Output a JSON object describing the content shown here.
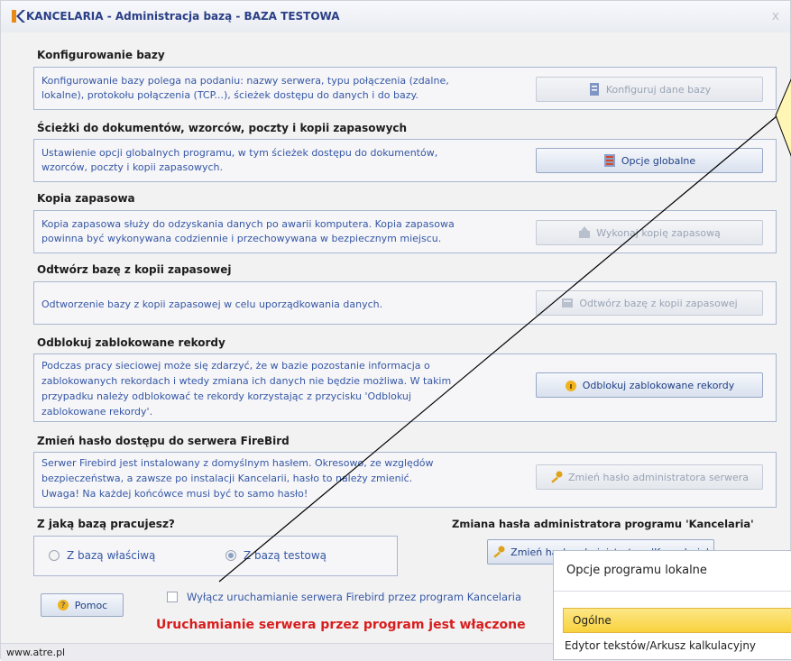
{
  "window": {
    "title": "KANCELARIA - Administracja bazą - BAZA TESTOWA",
    "close_label": "x"
  },
  "sections": {
    "konfiguracja": {
      "heading": "Konfigurowanie bazy",
      "desc_line1": "Konfigurowanie bazy polega na podaniu: nazwy serwera, typu połączenia (zdalne,",
      "desc_line2": "lokalne), protokołu połączenia (TCP...), ścieżek dostępu do danych i do bazy.",
      "button": "Konfiguruj dane bazy"
    },
    "sciezki": {
      "heading": "Ścieżki do dokumentów, wzorców, poczty i kopii zapasowych",
      "desc_line1": "Ustawienie opcji globalnych programu, w tym ścieżek dostępu do dokumentów,",
      "desc_line2": "wzorców, poczty i kopii zapasowych.",
      "button": "Opcje globalne"
    },
    "kopia": {
      "heading": "Kopia zapasowa",
      "desc_line1": "Kopia zapasowa służy do odzyskania danych po awarii komputera. Kopia zapasowa",
      "desc_line2": "powinna być wykonywana codziennie i przechowywana w bezpiecznym miejscu.",
      "button": "Wykonaj kopię zapasową"
    },
    "odtworz": {
      "heading": "Odtwórz bazę z kopii zapasowej",
      "desc_line1": "Odtworzenie bazy z kopii zapasowej  w celu uporządkowania danych.",
      "button": "Odtwórz bazę z kopii zapasowej"
    },
    "odblokuj": {
      "heading": "Odblokuj zablokowane rekordy",
      "desc_line1": "Podczas pracy sieciowej może się zdarzyć, że w bazie pozostanie informacja o",
      "desc_line2": "zablokowanych rekordach i wtedy zmiana ich danych nie będzie możliwa. W takim",
      "desc_line3": "przypadku należy odblokować te rekordy korzystając z przycisku 'Odblokuj",
      "desc_line4": "zablokowane rekordy'.",
      "button": "Odblokuj zablokowane rekordy"
    },
    "haslo": {
      "heading": "Zmień hasło dostępu do serwera FireBird",
      "desc_line1": "Serwer Firebird jest instalowany z domyślnym hasłem. Okresowo, ze względów",
      "desc_line2": "bezpieczeństwa, a zawsze po instalacji Kancelarii, hasło to należy zmienić.",
      "desc_line3": "Uwaga! Na każdej końcówce musi być to samo hasło!",
      "button": "Zmień hasło administratora serwera"
    }
  },
  "baza": {
    "heading": "Z jaką bazą pracujesz?",
    "option1": "Z bazą właściwą",
    "option2": "Z bazą testową",
    "selected": "Z bazą testową"
  },
  "admin_haslo": {
    "heading": "Zmiana hasła administratora programu 'Kancelaria'",
    "button": "Zmień hasło administratora 'Kancelaria'"
  },
  "bottom": {
    "help_button": "Pomoc",
    "checkbox_label": "Wyłącz uruchamianie serwera Firebird przez program Kancelaria",
    "checkbox_checked": false,
    "warning": "Uruchamianie serwera przez program jest włączone"
  },
  "statusbar": {
    "text": "www.atre.pl"
  },
  "popup": {
    "title": "Opcje programu lokalne",
    "items": [
      "Ogólne",
      "Edytor tekstów/Arkusz kalkulacyjny"
    ],
    "selected": "Ogólne"
  },
  "colors": {
    "title_text": "#2a3f86",
    "desc_text": "#3557a5",
    "warning_text": "#d81d1d",
    "panel_border": "#a9b7d0",
    "selected_item": "#f8d23d",
    "callout_fill": "#fff6b6"
  }
}
